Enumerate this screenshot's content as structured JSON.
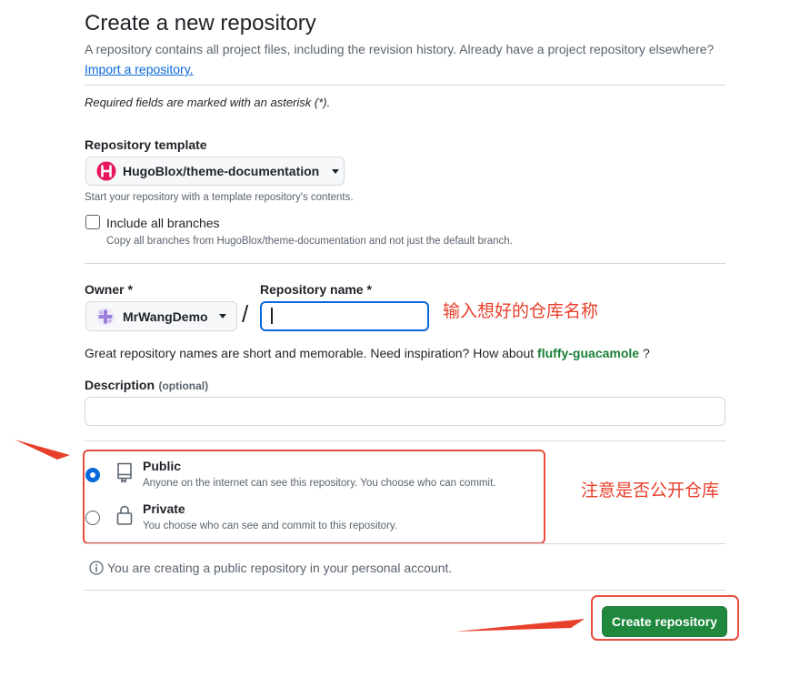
{
  "header": {
    "title": "Create a new repository",
    "subtitle": "A repository contains all project files, including the revision history. Already have a project repository elsewhere?",
    "import_link": "Import a repository."
  },
  "required_note": "Required fields are marked with an asterisk (*).",
  "template": {
    "label": "Repository template",
    "selected": "HugoBlox/theme-documentation",
    "note": "Start your repository with a template repository's contents."
  },
  "include_branches": {
    "label": "Include all branches",
    "note": "Copy all branches from HugoBlox/theme-documentation and not just the default branch.",
    "checked": false
  },
  "owner": {
    "label": "Owner *",
    "selected": "MrWangDemo"
  },
  "separator": "/",
  "repo_name": {
    "label": "Repository name *",
    "value": ""
  },
  "name_suggestion": {
    "text": "Great repository names are short and memorable. Need inspiration? How about",
    "suggestion": "fluffy-guacamole",
    "suffix": "?"
  },
  "description": {
    "label": "Description",
    "optional": "(optional)",
    "value": ""
  },
  "visibility": {
    "public": {
      "label": "Public",
      "note": "Anyone on the internet can see this repository. You choose who can commit.",
      "selected": true
    },
    "private": {
      "label": "Private",
      "note": "You choose who can see and commit to this repository.",
      "selected": false
    }
  },
  "info_note": "You are creating a public repository in your personal account.",
  "create_button": "Create repository",
  "annotations": {
    "repo_name_hint": "输入想好的仓库名称",
    "visibility_hint": "注意是否公开仓库"
  },
  "colors": {
    "primary_button": "#1f883d",
    "link": "#0969da",
    "annotation": "#e74c3c",
    "suggestion": "#1a7f37"
  }
}
